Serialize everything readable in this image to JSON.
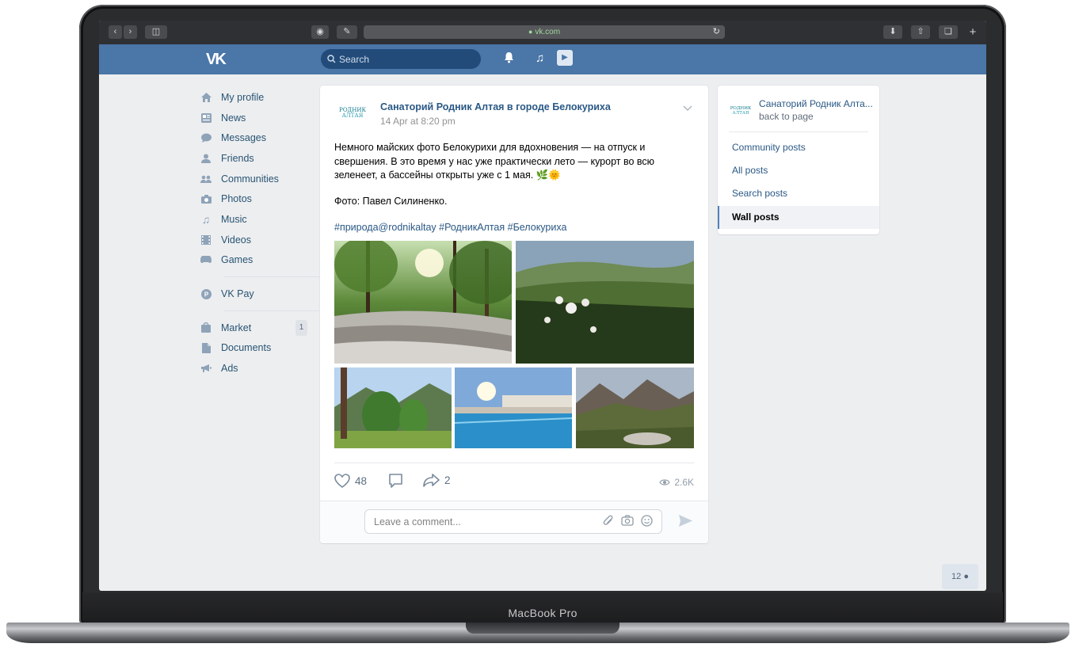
{
  "device": {
    "label": "MacBook Pro"
  },
  "browser": {
    "url": "vk.com"
  },
  "header": {
    "logo": "VK",
    "search_placeholder": "Search"
  },
  "left_nav": {
    "items": [
      {
        "label": "My profile",
        "icon": "home-icon"
      },
      {
        "label": "News",
        "icon": "news-icon"
      },
      {
        "label": "Messages",
        "icon": "messages-icon"
      },
      {
        "label": "Friends",
        "icon": "friends-icon"
      },
      {
        "label": "Communities",
        "icon": "communities-icon"
      },
      {
        "label": "Photos",
        "icon": "camera-icon"
      },
      {
        "label": "Music",
        "icon": "music-icon"
      },
      {
        "label": "Videos",
        "icon": "video-icon"
      },
      {
        "label": "Games",
        "icon": "gamepad-icon"
      }
    ],
    "pay": {
      "label": "VK Pay",
      "icon": "vkpay-icon"
    },
    "extra": [
      {
        "label": "Market",
        "icon": "market-icon",
        "badge": "1"
      },
      {
        "label": "Documents",
        "icon": "document-icon"
      },
      {
        "label": "Ads",
        "icon": "megaphone-icon"
      }
    ]
  },
  "post": {
    "author": "Санаторий Родник Алтая в городе Белокуриха",
    "date": "14 Apr at 8:20 pm",
    "avatar_text_top": "РОДНИК",
    "avatar_text_bottom": "АЛТАЯ",
    "text": "Немного майских фото Белокурихи для вдохновения — на отпуск и свершения. В это время у нас уже практически лето — курорт во всю зеленеет, а бассейны открыты уже с 1 мая. 🌿🌞",
    "caption": "Фото: Павел Силиненко.",
    "hashtags": "#природа@rodnikaltay #РодникАлтая #Белокуриха",
    "likes": "48",
    "shares": "2",
    "views": "2.6K",
    "comment_placeholder": "Leave a comment..."
  },
  "right_panel": {
    "community_name": "Санаторий Родник Алта...",
    "back_label": "back to page",
    "items": [
      {
        "label": "Community posts",
        "active": false
      },
      {
        "label": "All posts",
        "active": false
      },
      {
        "label": "Search posts",
        "active": false
      },
      {
        "label": "Wall posts",
        "active": true
      }
    ]
  },
  "online_friends": {
    "count": "12"
  },
  "colors": {
    "vk_blue": "#4a76a8",
    "link": "#2a5885",
    "page_bg": "#edeef0"
  }
}
